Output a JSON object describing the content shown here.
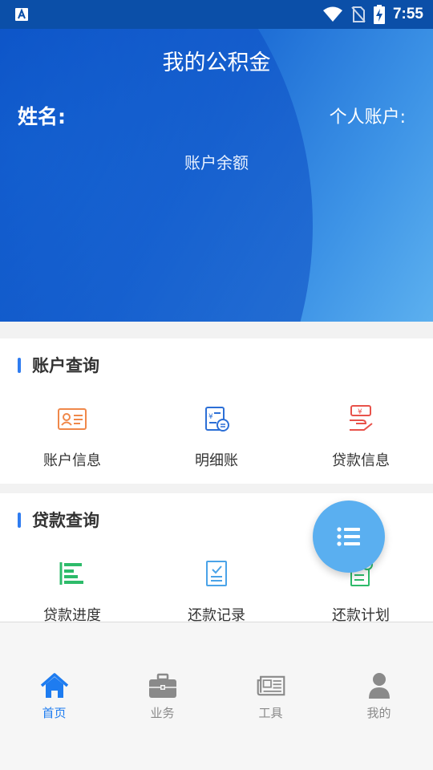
{
  "status_bar": {
    "time": "7:55",
    "icons": [
      "app-notification-icon",
      "wifi-icon",
      "no-sim-icon",
      "battery-charging-icon"
    ]
  },
  "header": {
    "title": "我的公积金",
    "name_label": "姓名:",
    "account_label": "个人账户:",
    "balance_label": "账户余额"
  },
  "account_section": {
    "title": "账户查询",
    "items": [
      {
        "label": "账户信息",
        "icon": "id-card-icon"
      },
      {
        "label": "明细账",
        "icon": "ledger-icon"
      },
      {
        "label": "贷款信息",
        "icon": "loan-info-icon"
      }
    ]
  },
  "loan_section": {
    "title": "贷款查询",
    "items": [
      {
        "label": "贷款进度",
        "icon": "progress-icon"
      },
      {
        "label": "还款记录",
        "icon": "checklist-icon"
      },
      {
        "label": "还款计划",
        "icon": "repayment-plan-icon"
      }
    ]
  },
  "fab": {
    "icon": "list-icon"
  },
  "bottom_nav": {
    "items": [
      {
        "label": "首页",
        "icon": "home-icon",
        "active": true
      },
      {
        "label": "业务",
        "icon": "briefcase-icon",
        "active": false
      },
      {
        "label": "工具",
        "icon": "newspaper-icon",
        "active": false
      },
      {
        "label": "我的",
        "icon": "person-icon",
        "active": false
      }
    ]
  },
  "colors": {
    "accent": "#1e7cf0",
    "header_start": "#0a53c4",
    "header_end": "#5cb0ef",
    "fab": "#5aaff0",
    "icon_orange": "#f0884a",
    "icon_blue": "#2c6fd6",
    "icon_red": "#e8524a",
    "icon_green": "#2dbb6a",
    "icon_lightblue": "#4aa3e8"
  }
}
